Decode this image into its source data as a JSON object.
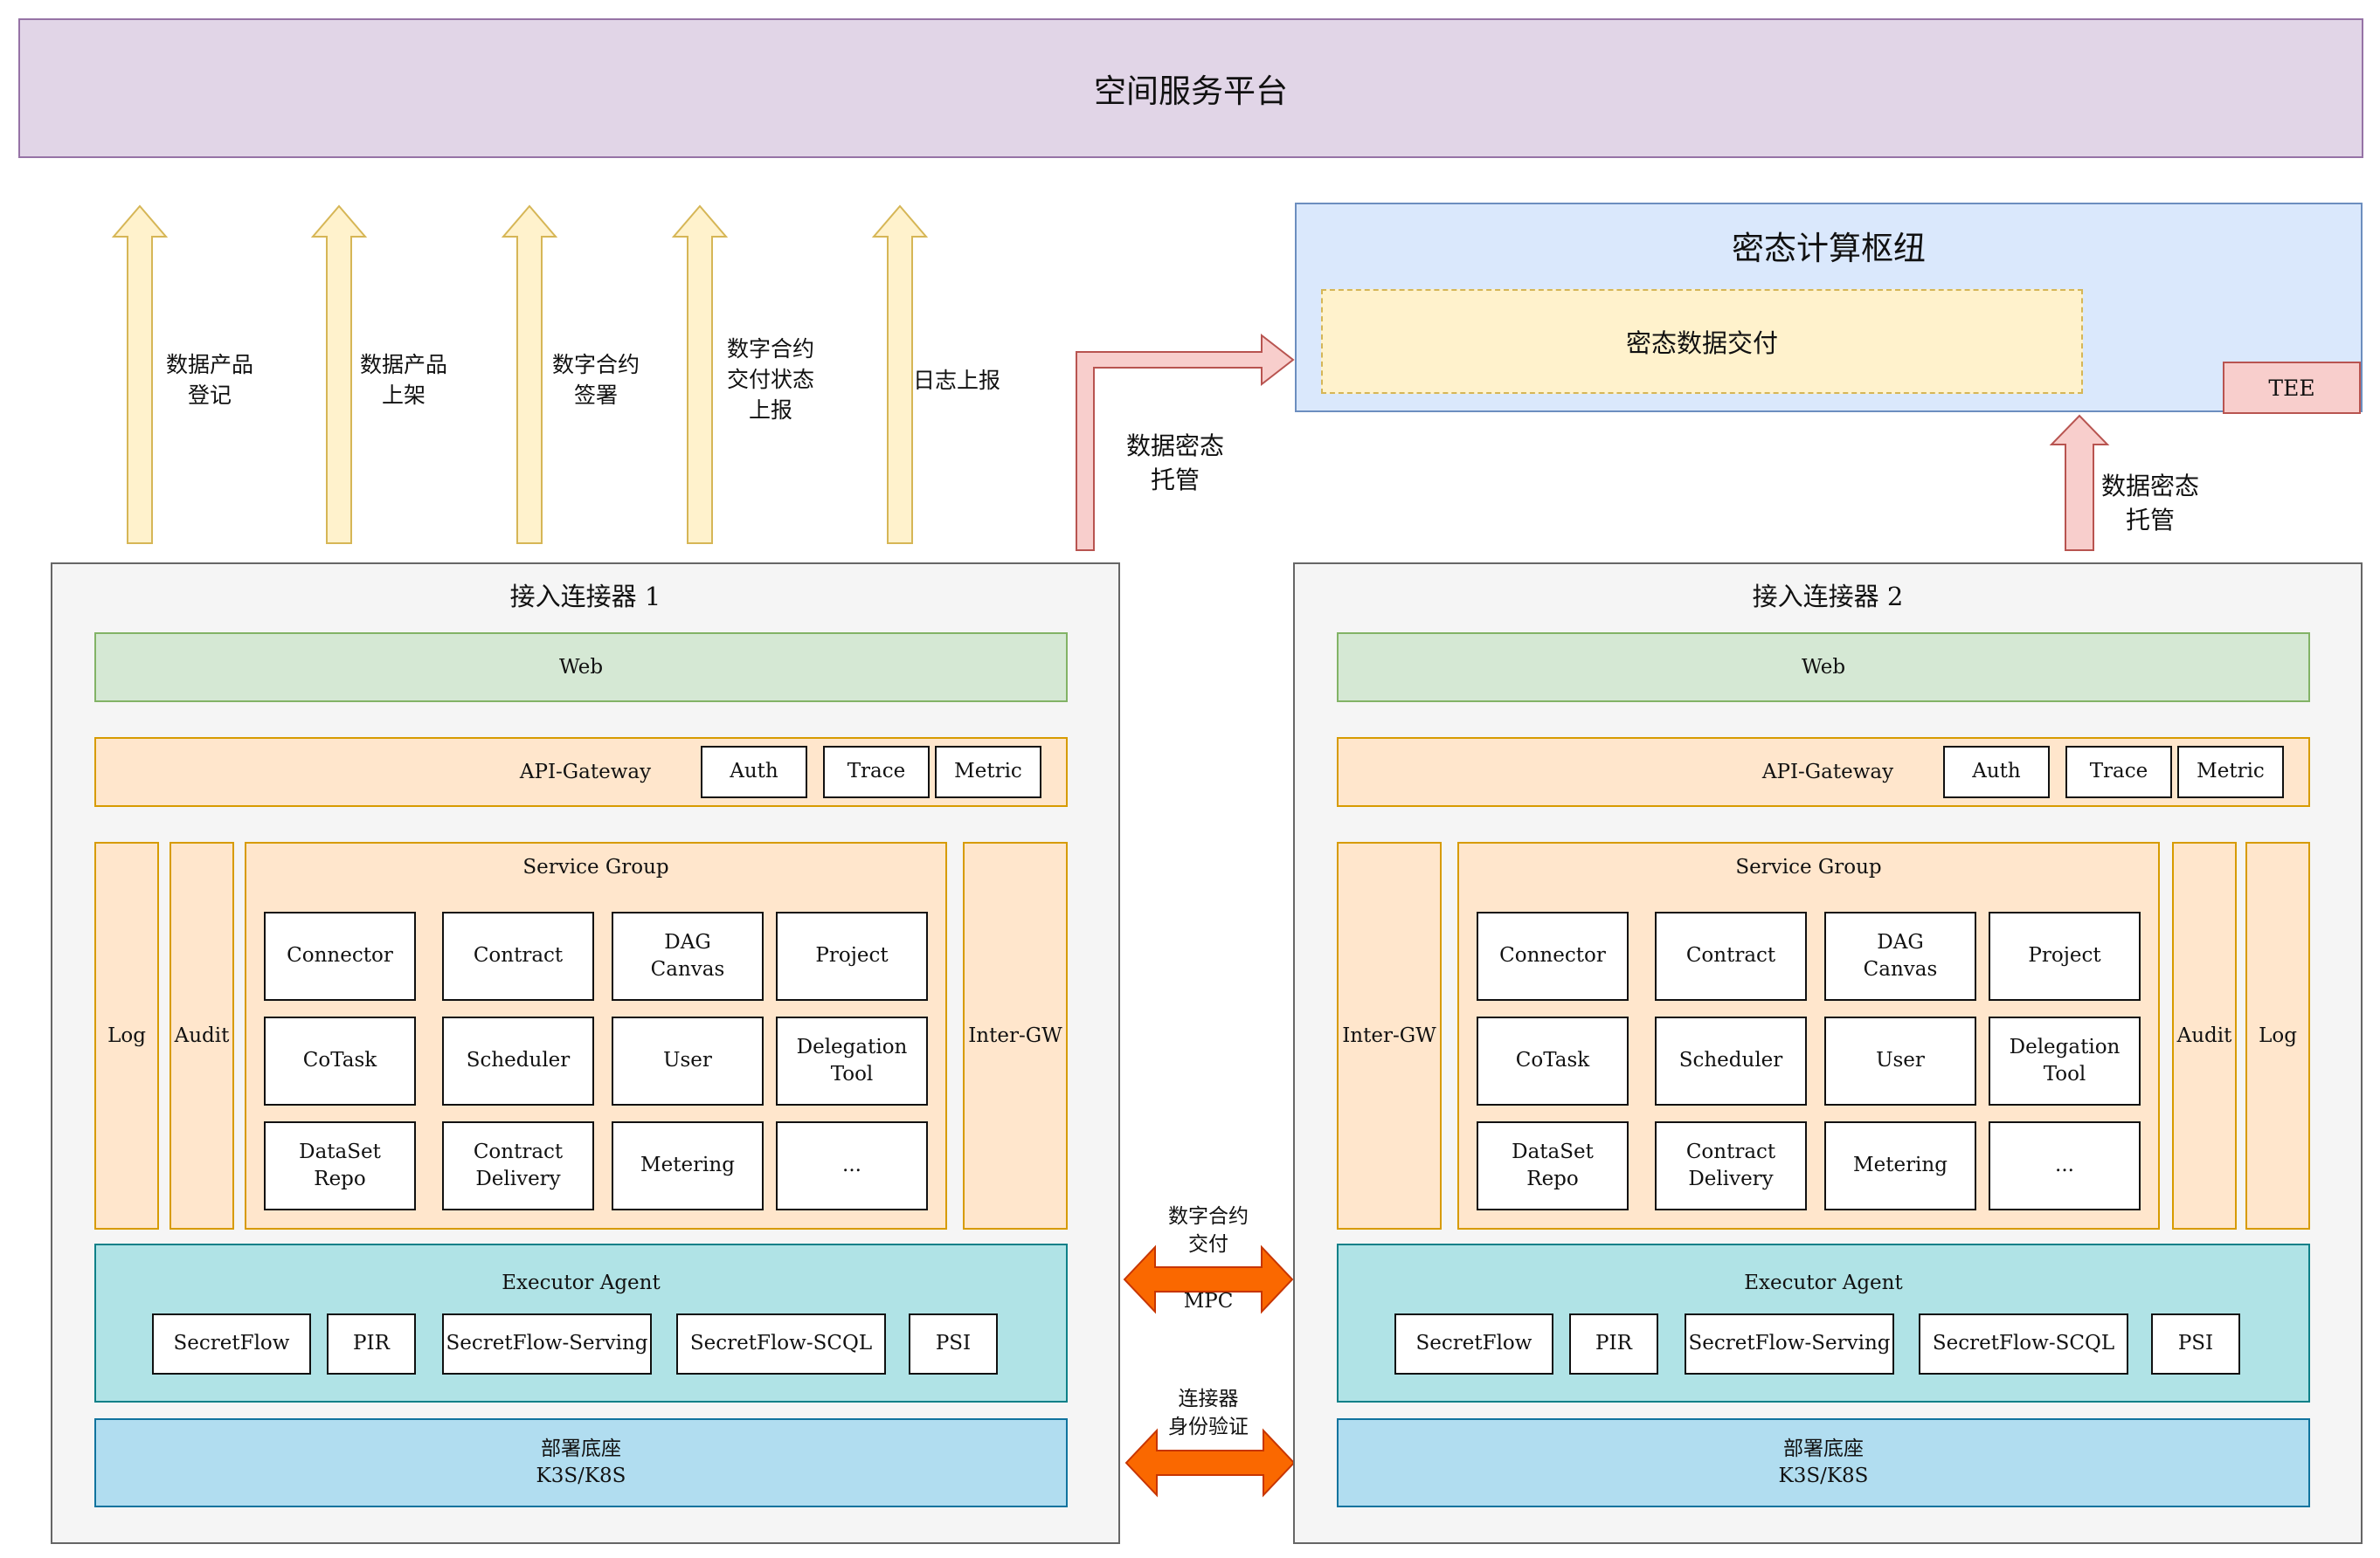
{
  "platform": {
    "title": "空间服务平台"
  },
  "up_arrows": [
    {
      "label": "数据产品\n登记"
    },
    {
      "label": "数据产品\n上架"
    },
    {
      "label": "数字合约\n签署"
    },
    {
      "label": "数字合约\n交付状态\n上报"
    },
    {
      "label": "日志上报"
    }
  ],
  "mpc_hub": {
    "title": "密态计算枢纽",
    "delivery": "密态数据交付",
    "tee": "TEE"
  },
  "custody_arrows": {
    "left": "数据密态\n托管",
    "right": "数据密态\n托管"
  },
  "middle_arrows": {
    "contract_top": "数字合约\n交付",
    "contract_bottom": "MPC",
    "identity": "连接器\n身份验证"
  },
  "connectors": [
    {
      "title": "接入连接器 1",
      "web": "Web",
      "gateway": {
        "label": "API-Gateway",
        "auth": "Auth",
        "trace": "Trace",
        "metric": "Metric"
      },
      "log": "Log",
      "audit": "Audit",
      "intergw": "Inter-GW",
      "service_group": {
        "title": "Service Group",
        "items": [
          "Connector",
          "Contract",
          "DAG\nCanvas",
          "Project",
          "CoTask",
          "Scheduler",
          "User",
          "Delegation\nTool",
          "DataSet\nRepo",
          "Contract\nDelivery",
          "Metering",
          "..."
        ]
      },
      "executor": {
        "title": "Executor Agent",
        "items": [
          "SecretFlow",
          "PIR",
          "SecretFlow-Serving",
          "SecretFlow-SCQL",
          "PSI"
        ]
      },
      "base": "部署底座\nK3S/K8S"
    },
    {
      "title": "接入连接器 2",
      "web": "Web",
      "gateway": {
        "label": "API-Gateway",
        "auth": "Auth",
        "trace": "Trace",
        "metric": "Metric"
      },
      "log": "Log",
      "audit": "Audit",
      "intergw": "Inter-GW",
      "service_group": {
        "title": "Service Group",
        "items": [
          "Connector",
          "Contract",
          "DAG\nCanvas",
          "Project",
          "CoTask",
          "Scheduler",
          "User",
          "Delegation\nTool",
          "DataSet\nRepo",
          "Contract\nDelivery",
          "Metering",
          "..."
        ]
      },
      "executor": {
        "title": "Executor Agent",
        "items": [
          "SecretFlow",
          "PIR",
          "SecretFlow-Serving",
          "SecretFlow-SCQL",
          "PSI"
        ]
      },
      "base": "部署底座\nK3S/K8S"
    }
  ],
  "colors": {
    "platform": "#e1d5e7",
    "hub": "#dae8fc",
    "delivery": "#fff2cc",
    "tee": "#f8cecc",
    "web": "#d5e8d4",
    "service": "#ffe6cc",
    "executor": "#b0e3e6",
    "base": "#b1ddf0",
    "up_arrow": "#fff2cc",
    "custody_arrow": "#f8cecc",
    "bidirectional_arrow": "#fa6800"
  }
}
